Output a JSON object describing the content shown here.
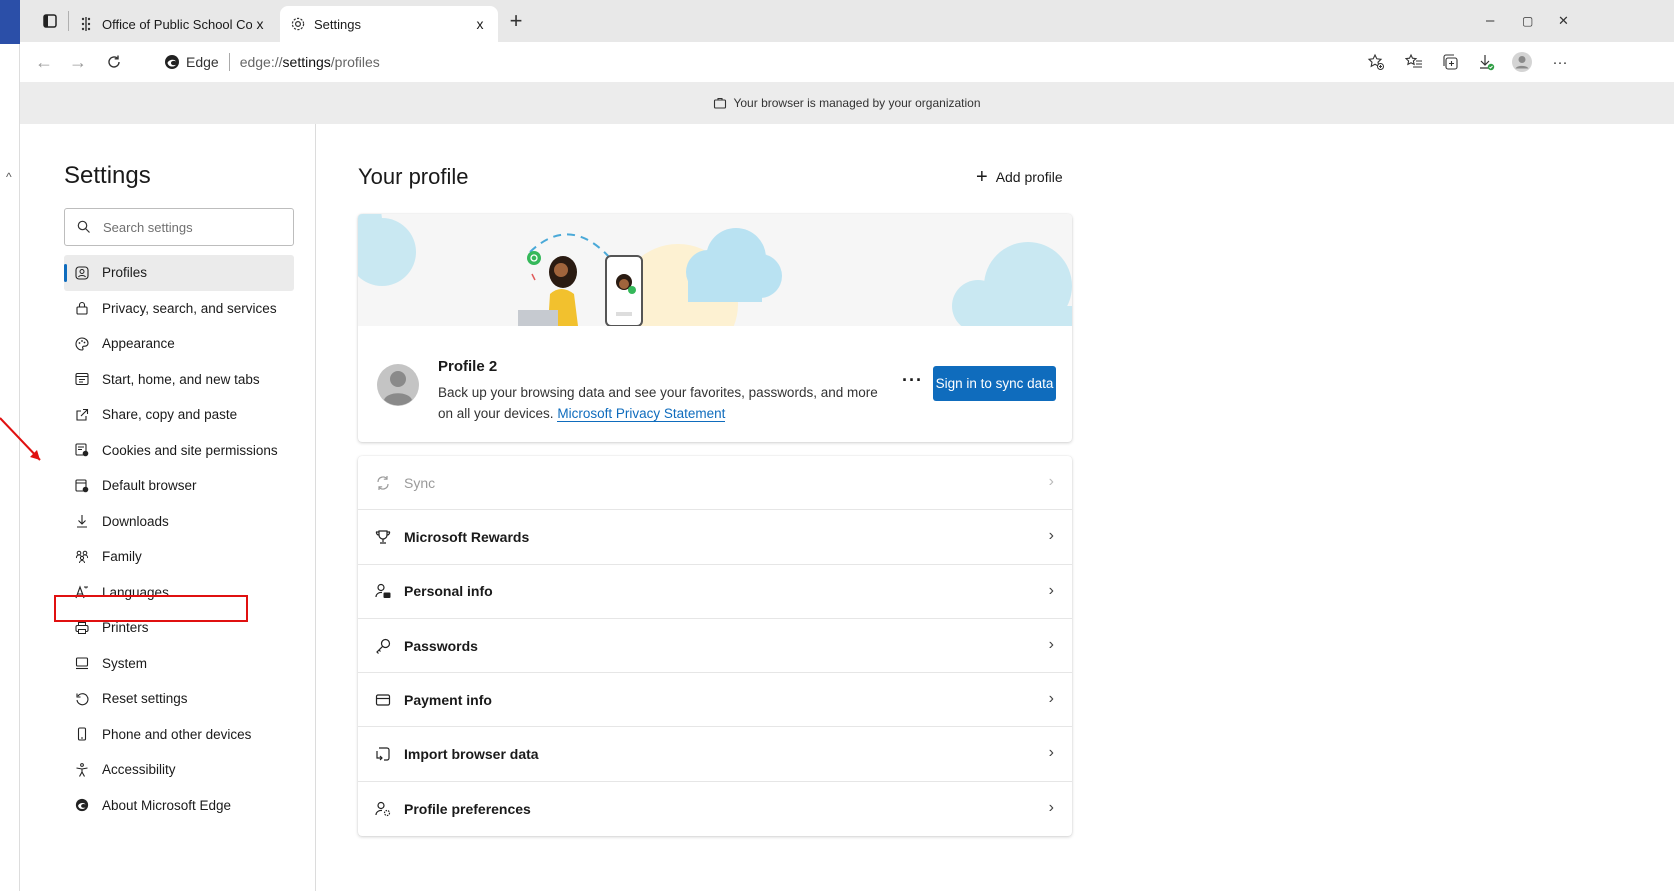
{
  "tabs": [
    {
      "title": "Office of Public School Construct",
      "close": "x"
    },
    {
      "title": "Settings",
      "close": "x"
    }
  ],
  "window_controls": {
    "minimize": "–",
    "restore": "▢",
    "close": "✕"
  },
  "address": {
    "brand": "Edge",
    "scheme": "edge://",
    "host": "settings",
    "path": "/profiles"
  },
  "managed_banner": "Your browser is managed by your organization",
  "sidebar": {
    "title": "Settings",
    "search_placeholder": "Search settings",
    "items": [
      {
        "label": "Profiles",
        "icon": "profile-icon"
      },
      {
        "label": "Privacy, search, and services",
        "icon": "lock-icon"
      },
      {
        "label": "Appearance",
        "icon": "palette-icon"
      },
      {
        "label": "Start, home, and new tabs",
        "icon": "home-tabs-icon"
      },
      {
        "label": "Share, copy and paste",
        "icon": "share-icon"
      },
      {
        "label": "Cookies and site permissions",
        "icon": "cookies-icon"
      },
      {
        "label": "Default browser",
        "icon": "default-browser-icon"
      },
      {
        "label": "Downloads",
        "icon": "download-icon"
      },
      {
        "label": "Family",
        "icon": "family-icon"
      },
      {
        "label": "Languages",
        "icon": "languages-icon"
      },
      {
        "label": "Printers",
        "icon": "printer-icon"
      },
      {
        "label": "System",
        "icon": "system-icon"
      },
      {
        "label": "Reset settings",
        "icon": "reset-icon"
      },
      {
        "label": "Phone and other devices",
        "icon": "phone-icon"
      },
      {
        "label": "Accessibility",
        "icon": "accessibility-icon"
      },
      {
        "label": "About Microsoft Edge",
        "icon": "edge-icon"
      }
    ]
  },
  "main": {
    "title": "Your profile",
    "add_profile": "Add profile",
    "profile": {
      "name": "Profile 2",
      "description": "Back up your browsing data and see your favorites, passwords, and more on all your devices.",
      "privacy_link": "Microsoft Privacy Statement",
      "more": "···",
      "signin_button": "Sign in to sync data"
    },
    "settings": [
      {
        "label": "Sync",
        "icon": "sync-icon",
        "disabled": true
      },
      {
        "label": "Microsoft Rewards",
        "icon": "trophy-icon"
      },
      {
        "label": "Personal info",
        "icon": "personal-info-icon"
      },
      {
        "label": "Passwords",
        "icon": "key-icon"
      },
      {
        "label": "Payment info",
        "icon": "card-icon"
      },
      {
        "label": "Import browser data",
        "icon": "import-icon"
      },
      {
        "label": "Profile preferences",
        "icon": "profile-prefs-icon"
      }
    ]
  },
  "colors": {
    "accent": "#0f6cbd",
    "highlight": "#e01010"
  }
}
